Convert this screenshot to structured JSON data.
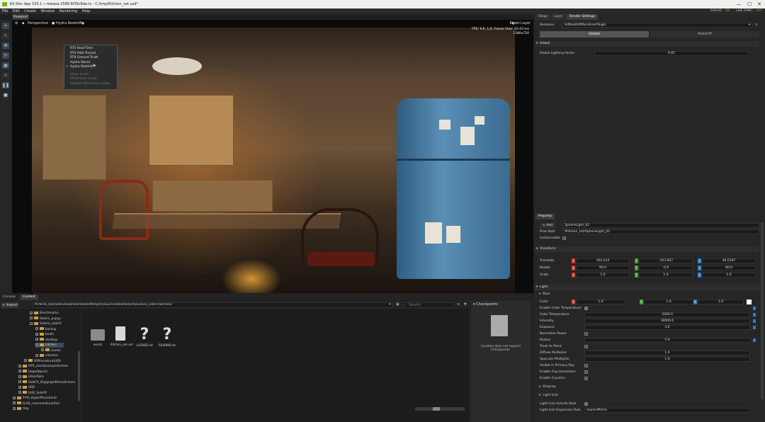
{
  "titlebar": {
    "title": "Kit Dev App 103.1 • release.2588.6f35c8de.tc - C:/tmp/Kitchen_set.usd*",
    "minimize": "—",
    "maximize": "☐",
    "close": "✕"
  },
  "menubar": {
    "items": [
      "File",
      "Edit",
      "Create",
      "Window",
      "Rendering",
      "Help"
    ],
    "cache_label": "CACHE:",
    "cache_value": "ON",
    "livesync_label": "LIVE SYNC:",
    "livesync_value": "OFF"
  },
  "viewport": {
    "tab": "Viewport",
    "camera": "Perspective",
    "renderer_label": "Hydra Redshift",
    "reset_label": "Reset Layer",
    "stats_line1": "FPS: 9.6, 1.0, Frame time: 10.43 ms",
    "stats_line2": "1280x720"
  },
  "render_menu": {
    "items": [
      {
        "label": "RTX Real-Time",
        "checked": false,
        "disabled": false
      },
      {
        "label": "RTX Path-Traced",
        "checked": false,
        "disabled": false
      },
      {
        "label": "RTX Ground Truth",
        "checked": false,
        "disabled": false
      },
      {
        "label": "Hydra Storm",
        "checked": false,
        "disabled": false
      },
      {
        "label": "Hydra Redshift",
        "checked": true,
        "disabled": false
      },
      {
        "label": "",
        "checked": false,
        "disabled": true
      },
      {
        "label": "Show mode",
        "checked": false,
        "disabled": true
      },
      {
        "label": "Wireframe mode",
        "checked": false,
        "disabled": true
      },
      {
        "label": "Shaded Wireframe mode",
        "checked": false,
        "disabled": true
      }
    ]
  },
  "right_tabs": [
    "Stage",
    "Layer",
    "Render Settings"
  ],
  "render_settings": {
    "renderer_label": "Renderer",
    "renderer_value": "HdRedshiftRendererPlugin",
    "sub_tabs": [
      "Global",
      "Redshift"
    ],
    "global_section": "Global",
    "lighting_factor_label": "Global Lighting Factor",
    "lighting_factor_value": "0.65"
  },
  "property": {
    "tab": "Property",
    "add_label": "+ Add",
    "add_value": "SphereLight_02",
    "prim_path_label": "Prim Path",
    "prim_path_value": "/Kitchen_set/SphereLight_02",
    "instanceable_label": "Instanceable",
    "transform_section": "Transform",
    "translate_label": "Translate",
    "translate": [
      "104.214",
      "-103.607",
      "26.6187"
    ],
    "rotate_label": "Rotate",
    "rotate": [
      "90.0",
      "-0.0",
      "90.0"
    ],
    "scale_label": "Scale",
    "scale": [
      "1.0",
      "1.0",
      "1.0"
    ],
    "light_section": "Light",
    "main_section": "Main",
    "color_label": "Color",
    "color": [
      "1.0",
      "1.0",
      "1.0"
    ],
    "enable_ct_label": "Enable Color Temperature",
    "ct_label": "Color Temperature",
    "ct_value": "2000.0",
    "intensity_label": "Intensity",
    "intensity_value": "30000.0",
    "exposure_label": "Exposure",
    "exposure_value": "3.6",
    "normalize_label": "Normalize Power",
    "radius_label": "Radius",
    "radius_value": "5.0",
    "treat_label": "Treat As Point",
    "diffuse_label": "Diffuse Multiplier",
    "diffuse_value": "1.0",
    "specular_label": "Specular Multiplier",
    "specular_value": "1.0",
    "visible_label": "Visible in Primary Ray",
    "fog_label": "Enable Fog Interaction",
    "caustics_label": "Enable Caustics",
    "shaping_section": "Shaping",
    "lightlink_section": "Light Link",
    "ll_include_label": "Light Link Include Root",
    "ll_expansion_label": "Light Link Expansion Rule",
    "ll_expansion_value": "expandPrims"
  },
  "bottom": {
    "tabs": [
      "Console",
      "Content"
    ],
    "import_label": "+ Import",
    "path": "M:/N-RS_Hydra/development/Redshift4Hydra/SourceData/RSHydra/Solaris_sideFX/kitchen/",
    "search_placeholder": "Search",
    "tree": [
      {
        "label": "Benchmarks",
        "indent": 3,
        "exp": "+"
      },
      {
        "label": "Solaris_puppy",
        "indent": 3,
        "exp": "+"
      },
      {
        "label": "Solaris_sideFX",
        "indent": 3,
        "exp": "-"
      },
      {
        "label": "backup",
        "indent": 4,
        "exp": "+"
      },
      {
        "label": "boats",
        "indent": 4,
        "exp": "+"
      },
      {
        "label": "desktop",
        "indent": 4,
        "exp": "+"
      },
      {
        "label": "kitchen",
        "indent": 4,
        "exp": "-",
        "selected": true
      },
      {
        "label": "assets",
        "indent": 5,
        "exp": "+"
      },
      {
        "label": "volumes",
        "indent": 4,
        "exp": "+"
      },
      {
        "label": "RSProceduralUSD",
        "indent": 2,
        "exp": "+"
      },
      {
        "label": "HTR_roomExampleScenes",
        "indent": 1,
        "exp": "+"
      },
      {
        "label": "largeObjects",
        "indent": 1,
        "exp": "+"
      },
      {
        "label": "otherData",
        "indent": 1,
        "exp": "+"
      },
      {
        "label": "SideFX_DigigraphDemoScenes",
        "indent": 1,
        "exp": "+"
      },
      {
        "label": "USD",
        "indent": 1,
        "exp": "+"
      },
      {
        "label": "USD_SideFX",
        "indent": 1,
        "exp": "+"
      },
      {
        "label": "P-RS_HyperProcedural",
        "indent": 0,
        "exp": "+"
      },
      {
        "label": "Q-RS_commandLineTool",
        "indent": 0,
        "exp": "+"
      },
      {
        "label": "tmp",
        "indent": 0,
        "exp": "+"
      }
    ],
    "files": [
      "assets",
      "Kitchen_set.usd",
      "LICENSE.txt",
      "README.txt"
    ],
    "checkpoints_title": "Checkpoints",
    "checkpoints_msg_1": "Location does not support",
    "checkpoints_msg_2": "Checkpoints."
  }
}
